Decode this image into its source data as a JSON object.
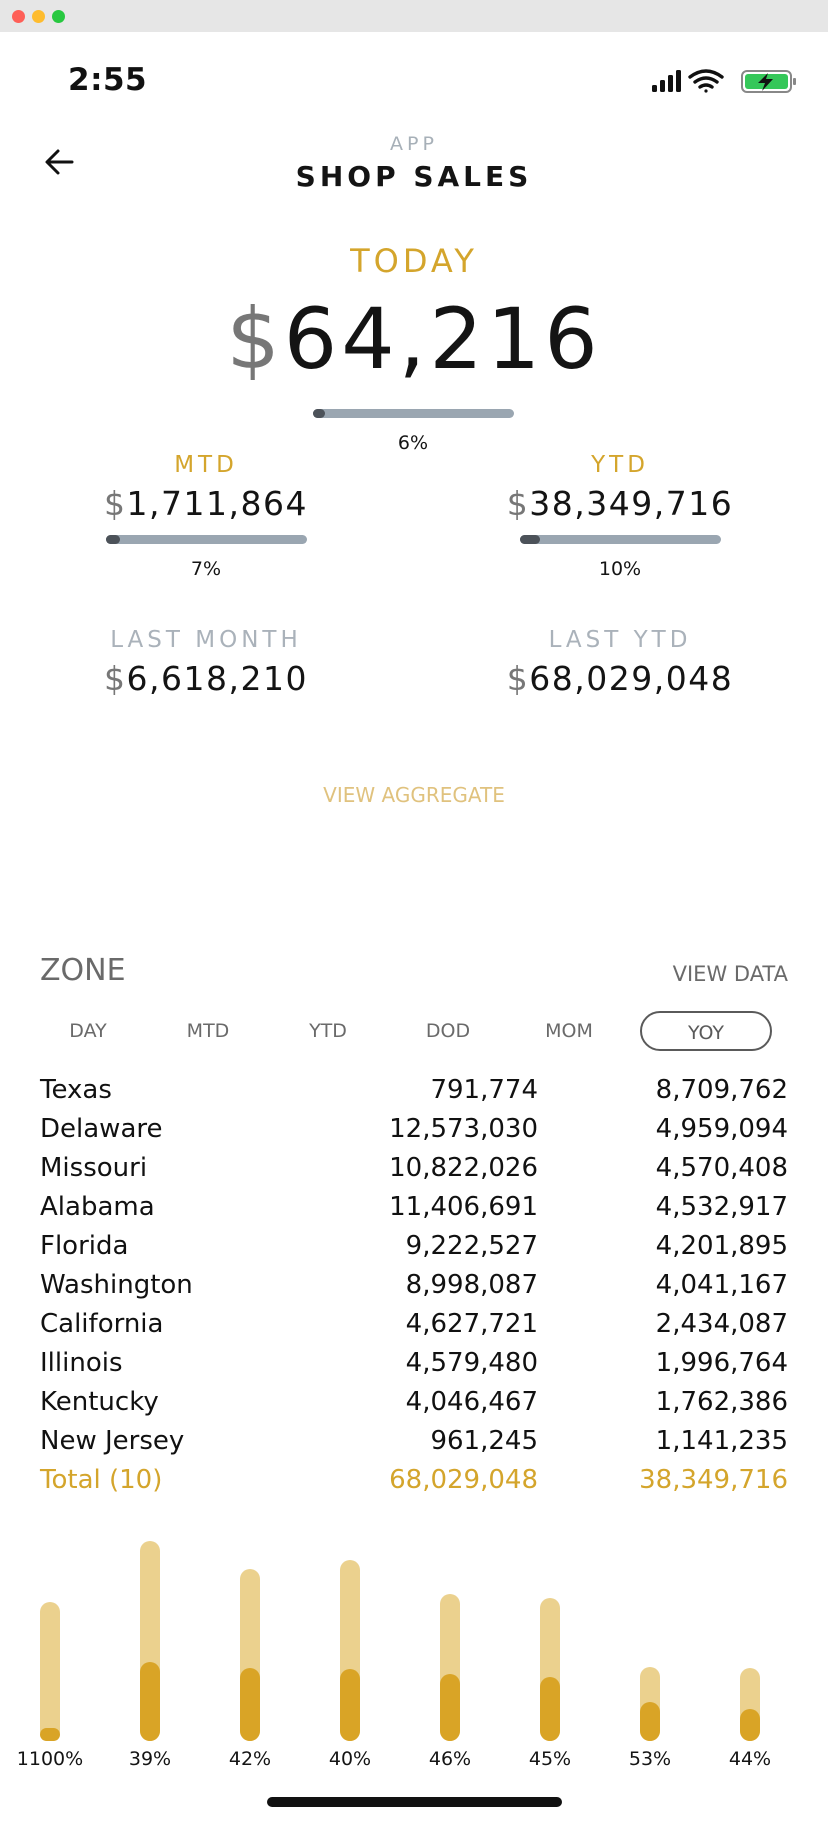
{
  "status_bar": {
    "time": "2:55"
  },
  "header": {
    "kicker": "APP",
    "title": "SHOP SALES",
    "back_icon": "arrow-left-icon"
  },
  "today": {
    "label": "TODAY",
    "currency": "$",
    "value": "64,216",
    "progress_label": "6%",
    "progress": 0.06
  },
  "metrics": [
    {
      "label": "MTD",
      "currency": "$",
      "value": "1,711,864",
      "progress_label": "7%",
      "progress": 0.07
    },
    {
      "label": "YTD",
      "currency": "$",
      "value": "38,349,716",
      "progress_label": "10%",
      "progress": 0.1
    }
  ],
  "previous": [
    {
      "label": "LAST MONTH",
      "currency": "$",
      "value": "6,618,210"
    },
    {
      "label": "LAST YTD",
      "currency": "$",
      "value": "68,029,048"
    }
  ],
  "view_aggregate": "VIEW AGGREGATE",
  "zone": {
    "title": "ZONE",
    "view_data": "VIEW DATA",
    "tabs": [
      "DAY",
      "MTD",
      "YTD",
      "DOD",
      "MOM",
      "YOY"
    ],
    "active_tab": "YOY",
    "rows": [
      {
        "name": "Texas",
        "c1": "791,774",
        "c2": "8,709,762"
      },
      {
        "name": "Delaware",
        "c1": "12,573,030",
        "c2": "4,959,094"
      },
      {
        "name": "Missouri",
        "c1": "10,822,026",
        "c2": "4,570,408"
      },
      {
        "name": "Alabama",
        "c1": "11,406,691",
        "c2": "4,532,917"
      },
      {
        "name": "Florida",
        "c1": "9,222,527",
        "c2": "4,201,895"
      },
      {
        "name": "Washington",
        "c1": "8,998,087",
        "c2": "4,041,167"
      },
      {
        "name": "California",
        "c1": "4,627,721",
        "c2": "2,434,087"
      },
      {
        "name": "Illinois",
        "c1": "4,579,480",
        "c2": "1,996,764"
      },
      {
        "name": "Kentucky",
        "c1": "4,046,467",
        "c2": "1,762,386"
      },
      {
        "name": "New Jersey",
        "c1": "961,245",
        "c2": "1,141,235"
      }
    ],
    "total": {
      "name": "Total (10)",
      "c1": "68,029,048",
      "c2": "38,349,716"
    }
  },
  "chart_data": {
    "type": "bar",
    "categories": [
      "1100%",
      "39%",
      "42%",
      "40%",
      "46%",
      "45%",
      "53%",
      "44%"
    ],
    "series": [
      {
        "values": [
          791774,
          12573030,
          10822026,
          11406691,
          9222527,
          8998087,
          4627721,
          4579480
        ]
      },
      {
        "values": [
          8709762,
          4959094,
          4570408,
          4532917,
          4201895,
          4041167,
          2434087,
          1996764
        ]
      }
    ],
    "colors": [
      "#ebd18e",
      "#d9a426"
    ]
  }
}
